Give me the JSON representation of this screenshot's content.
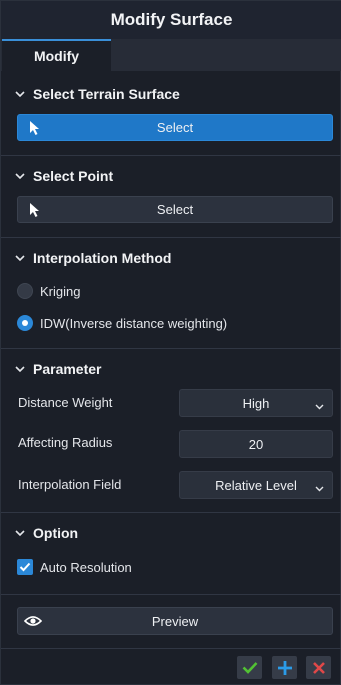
{
  "window": {
    "title": "Modify Surface"
  },
  "tabs": [
    {
      "label": "Modify"
    }
  ],
  "sections": {
    "terrain": {
      "title": "Select Terrain Surface",
      "button_label": "Select"
    },
    "point": {
      "title": "Select Point",
      "button_label": "Select"
    },
    "interpolation": {
      "title": "Interpolation Method",
      "options": [
        {
          "label": "Kriging",
          "selected": false
        },
        {
          "label": "IDW(Inverse distance weighting)",
          "selected": true
        }
      ]
    },
    "parameter": {
      "title": "Parameter",
      "distance_weight": {
        "label": "Distance Weight",
        "value": "High"
      },
      "affecting_radius": {
        "label": "Affecting Radius",
        "value": "20"
      },
      "interpolation_field": {
        "label": "Interpolation Field",
        "value": "Relative Level"
      }
    },
    "option": {
      "title": "Option",
      "auto_resolution": {
        "label": "Auto Resolution",
        "checked": true
      }
    }
  },
  "preview": {
    "label": "Preview"
  },
  "colors": {
    "background": "#1b1f28",
    "accent": "#1f78c8",
    "confirm": "#52c234",
    "add": "#2b9be8",
    "cancel": "#e04848"
  },
  "icons": {
    "section_toggle": "chevron-down-icon",
    "select": "cursor-arrow-icon",
    "preview": "eye-icon",
    "dropdown": "chevron-down-icon",
    "check": "checkmark-icon",
    "apply": "check-icon",
    "add": "plus-icon",
    "close": "close-icon"
  }
}
